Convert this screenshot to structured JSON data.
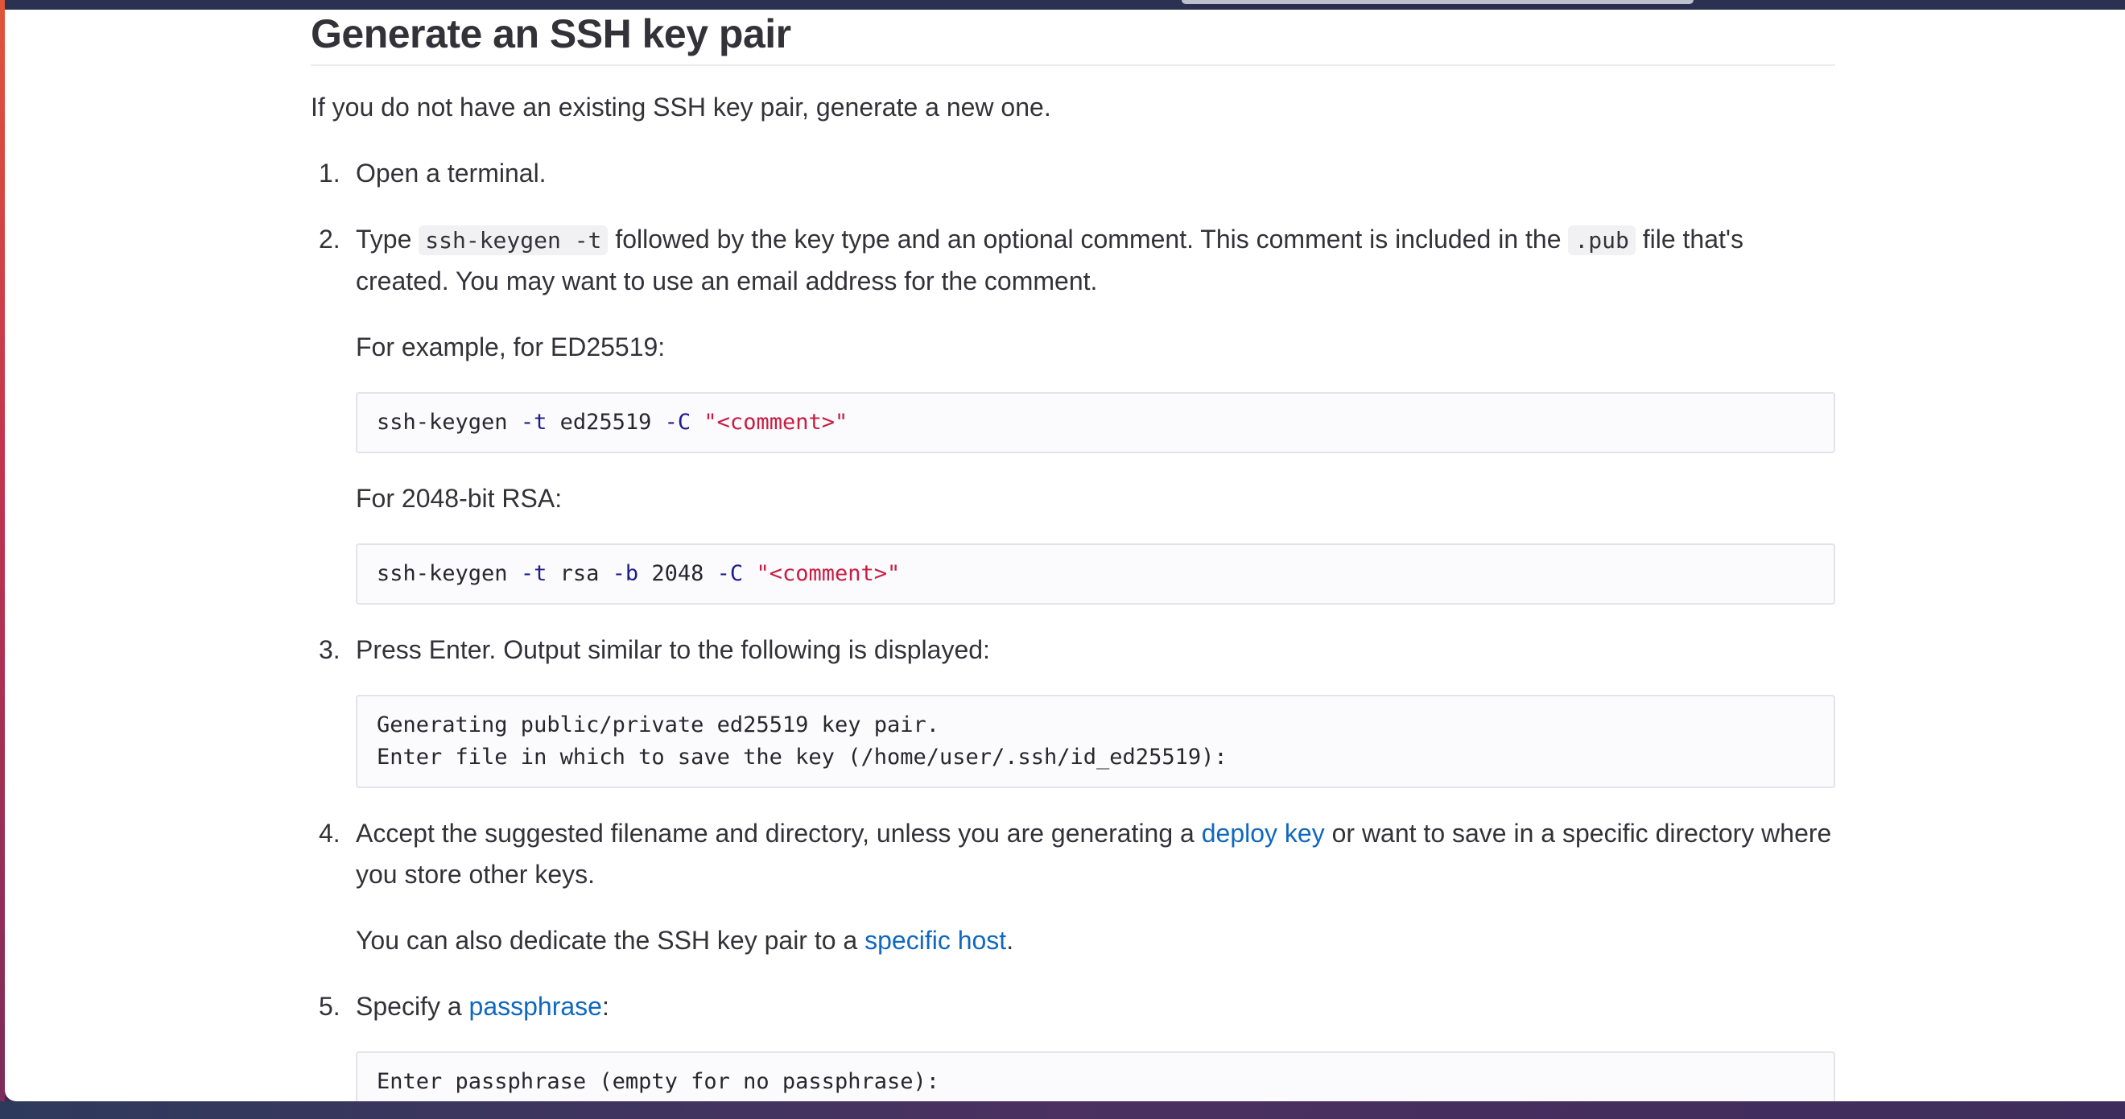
{
  "heading": "Generate an SSH key pair",
  "intro": "If you do not have an existing SSH key pair, generate a new one.",
  "steps": {
    "s1": {
      "num": "1.",
      "text": "Open a terminal."
    },
    "s2": {
      "num": "2.",
      "text_a": "Type ",
      "code_a": "ssh-keygen -t",
      "text_b": " followed by the key type and an optional comment. This comment is included in the ",
      "code_b": ".pub",
      "text_c": " file that's created. You may want to use an email address for the comment.",
      "example_ed": "For example, for ED25519:",
      "cmd_ed": {
        "cmd": "ssh-keygen ",
        "f1": "-t",
        "v1": " ed25519 ",
        "f2": "-C",
        "sp": " ",
        "str": "\"<comment>\""
      },
      "example_rsa": "For 2048-bit RSA:",
      "cmd_rsa": {
        "cmd": "ssh-keygen ",
        "f1": "-t",
        "v1": " rsa ",
        "f2": "-b",
        "v2": " 2048 ",
        "f3": "-C",
        "sp": " ",
        "str": "\"<comment>\""
      }
    },
    "s3": {
      "num": "3.",
      "text": "Press Enter. Output similar to the following is displayed:",
      "output_line1": "Generating public/private ed25519 key pair.",
      "output_line2": "Enter file in which to save the key (/home/user/.ssh/id_ed25519):"
    },
    "s4": {
      "num": "4.",
      "text_a": "Accept the suggested filename and directory, unless you are generating a ",
      "link_a": "deploy key",
      "text_b": " or want to save in a specific directory where you store other keys.",
      "sub_a": "You can also dedicate the SSH key pair to a ",
      "sub_link": "specific host",
      "sub_b": "."
    },
    "s5": {
      "num": "5.",
      "text_a": "Specify a ",
      "link": "passphrase",
      "text_b": ":",
      "output_line1": "Enter passphrase (empty for no passphrase):"
    }
  },
  "colors": {
    "link": "#1068bf",
    "code_flag": "#1e1e8a",
    "code_string": "#c91c42",
    "text": "#333238"
  }
}
